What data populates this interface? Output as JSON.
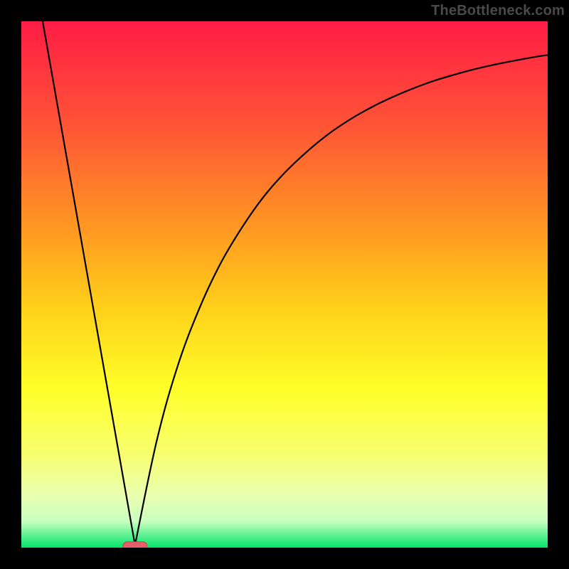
{
  "watermark": "TheBottleneck.com",
  "colors": {
    "frame": "#000000",
    "curve": "#000000",
    "marker_fill": "#e46066",
    "marker_stroke": "#c14b53",
    "gradient_stops": [
      {
        "offset": 0.0,
        "color": "#ff1c45"
      },
      {
        "offset": 0.2,
        "color": "#ff5536"
      },
      {
        "offset": 0.4,
        "color": "#ff9a21"
      },
      {
        "offset": 0.55,
        "color": "#ffd21a"
      },
      {
        "offset": 0.7,
        "color": "#ffff2a"
      },
      {
        "offset": 0.82,
        "color": "#f7ff6e"
      },
      {
        "offset": 0.9,
        "color": "#eaffb0"
      },
      {
        "offset": 0.95,
        "color": "#c9ffc0"
      },
      {
        "offset": 1.0,
        "color": "#00e56a"
      }
    ]
  },
  "chart_data": {
    "type": "line",
    "title": "",
    "xlabel": "",
    "ylabel": "",
    "xlim": [
      0,
      1
    ],
    "ylim": [
      0,
      1
    ],
    "legend": false,
    "grid": false,
    "series": [
      {
        "name": "curve",
        "segments": [
          {
            "kind": "linear",
            "x": [
              0.0405,
              0.216
            ],
            "y": [
              1.0,
              0.005
            ]
          },
          {
            "kind": "curve",
            "x": [
              0.216,
              0.257,
              0.297,
              0.338,
              0.378,
              0.419,
              0.459,
              0.5,
              0.541,
              0.581,
              0.622,
              0.662,
              0.703,
              0.743,
              0.784,
              0.824,
              0.865,
              0.905,
              0.946,
              0.986,
              1.0
            ],
            "y": [
              0.005,
              0.202,
              0.345,
              0.454,
              0.539,
              0.608,
              0.665,
              0.712,
              0.751,
              0.784,
              0.812,
              0.835,
              0.855,
              0.872,
              0.887,
              0.899,
              0.91,
              0.919,
              0.927,
              0.934,
              0.936
            ]
          }
        ]
      }
    ],
    "markers": [
      {
        "name": "min-marker",
        "x": 0.216,
        "y": 0.003,
        "shape": "pill"
      }
    ]
  }
}
